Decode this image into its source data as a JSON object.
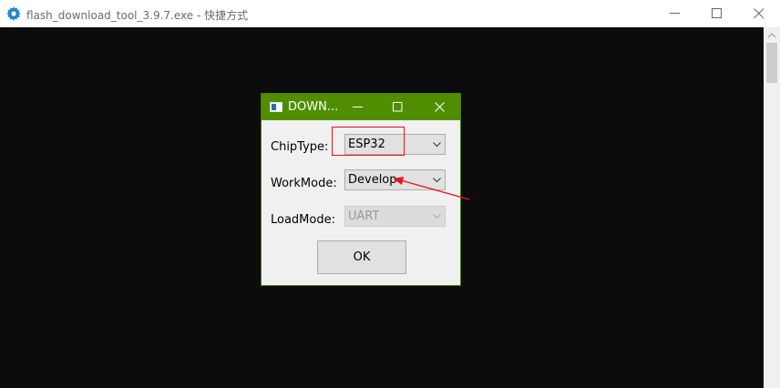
{
  "window": {
    "title": "flash_download_tool_3.9.7.exe - 快捷方式",
    "icon": "gear-icon"
  },
  "dialog": {
    "title": "DOWN...",
    "title_bar_color": "#4e8e00",
    "fields": {
      "chip_type": {
        "label": "ChipType:",
        "value": "ESP32"
      },
      "work_mode": {
        "label": "WorkMode:",
        "value": "Develop"
      },
      "load_mode": {
        "label": "LoadMode:",
        "value": "UART",
        "disabled": true
      }
    },
    "ok_label": "OK"
  },
  "annotations": {
    "color": "#e8141b",
    "highlight_target": "chip-type-combo",
    "arrow_target": "work-mode-combo"
  },
  "colors": {
    "console_bg": "#0c0c0c",
    "dialog_bg": "#f0f0f0"
  }
}
